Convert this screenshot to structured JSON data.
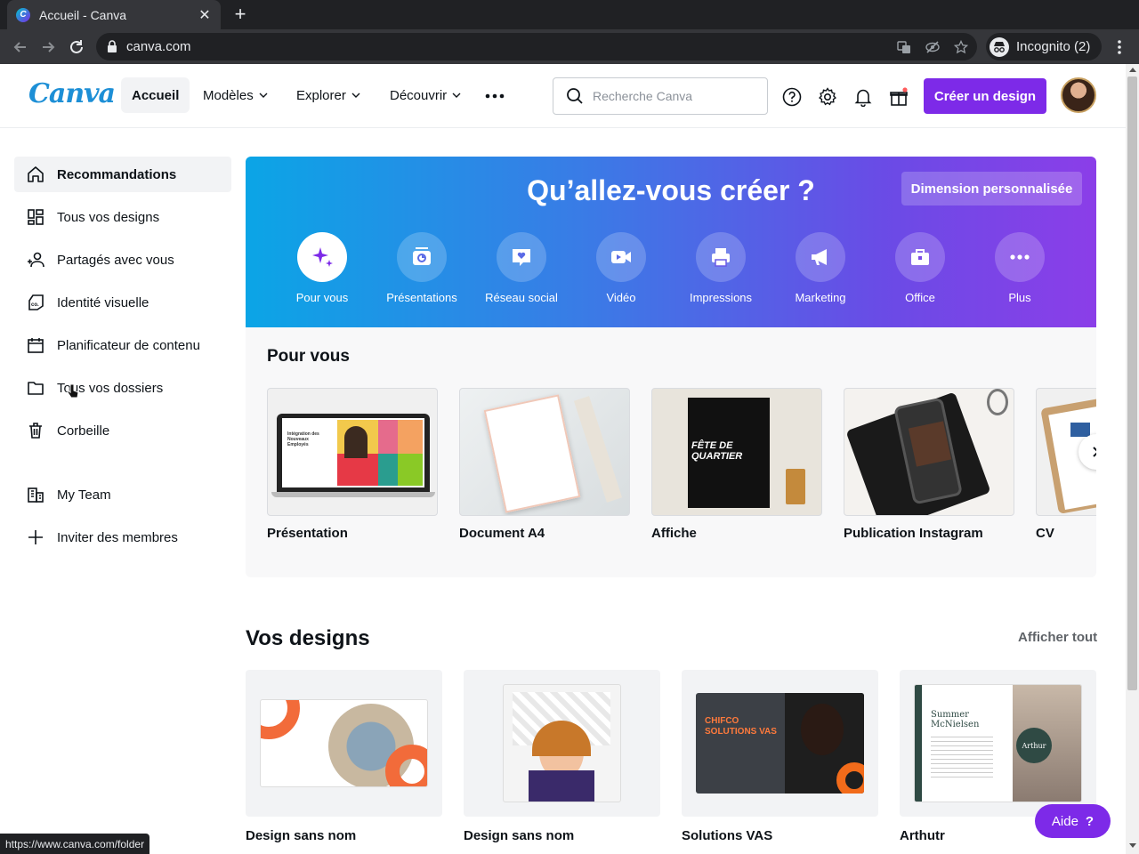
{
  "browser": {
    "tab_title": "Accueil - Canva",
    "url": "canva.com",
    "incognito_label": "Incognito (2)",
    "status_url": "https://www.canva.com/folder"
  },
  "header": {
    "logo": "Canva",
    "nav": [
      {
        "label": "Accueil"
      },
      {
        "label": "Modèles"
      },
      {
        "label": "Explorer"
      },
      {
        "label": "Découvrir"
      }
    ],
    "search_placeholder": "Recherche Canva",
    "create_label": "Créer un design"
  },
  "sidebar": {
    "items": [
      {
        "label": "Recommandations",
        "icon": "home-icon"
      },
      {
        "label": "Tous vos designs",
        "icon": "grid-icon"
      },
      {
        "label": "Partagés avec vous",
        "icon": "people-icon"
      },
      {
        "label": "Identité visuelle",
        "icon": "brand-icon"
      },
      {
        "label": "Planificateur de contenu",
        "icon": "calendar-icon"
      },
      {
        "label": "Tous vos dossiers",
        "icon": "folder-icon"
      },
      {
        "label": "Corbeille",
        "icon": "trash-icon"
      },
      {
        "label": "My Team",
        "icon": "team-icon"
      },
      {
        "label": "Inviter des membres",
        "icon": "plus-icon"
      }
    ]
  },
  "hero": {
    "title": "Qu’allez-vous créer ?",
    "custom_size": "Dimension personnalisée",
    "categories": [
      {
        "label": "Pour vous"
      },
      {
        "label": "Présentations"
      },
      {
        "label": "Réseau social"
      },
      {
        "label": "Vidéo"
      },
      {
        "label": "Impressions"
      },
      {
        "label": "Marketing"
      },
      {
        "label": "Office"
      },
      {
        "label": "Plus"
      }
    ]
  },
  "pour_vous": {
    "title": "Pour vous",
    "templates": [
      {
        "name": "Présentation",
        "thumb_text": "Intégration des Nouveaux Employés"
      },
      {
        "name": "Document A4"
      },
      {
        "name": "Affiche",
        "thumb_text": "FÊTE DE QUARTIER"
      },
      {
        "name": "Publication Instagram"
      },
      {
        "name": "CV"
      }
    ]
  },
  "vos_designs": {
    "title": "Vos designs",
    "see_all": "Afficher tout",
    "items": [
      {
        "name": "Design sans nom"
      },
      {
        "name": "Design sans nom"
      },
      {
        "name": "Solutions VAS",
        "thumb_text": "CHIFCO SOLUTIONS VAS"
      },
      {
        "name": "Arthutr",
        "thumb_text": "Summer McNielsen",
        "node_text": "Arthur"
      }
    ]
  },
  "help_label": "Aide",
  "colors": {
    "brand": "#7d2ae8",
    "logo": "#1d8fd6"
  }
}
